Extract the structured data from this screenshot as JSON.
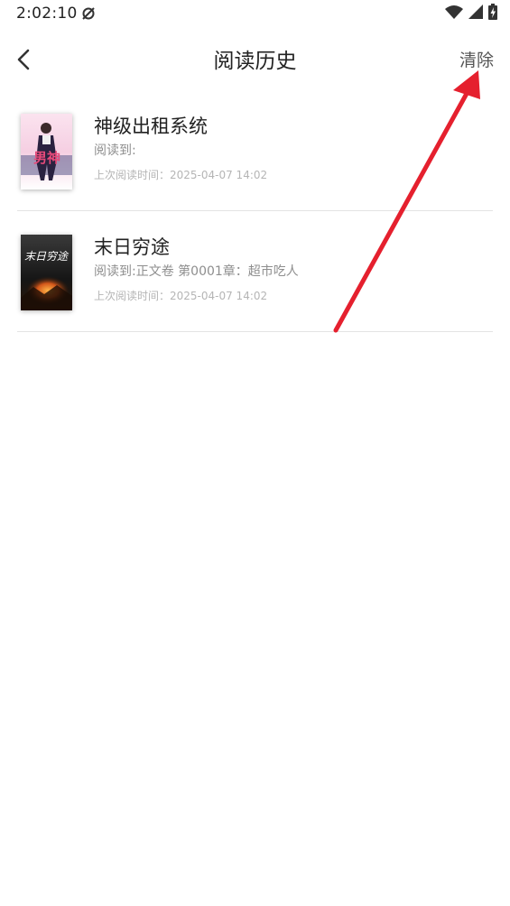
{
  "status_bar": {
    "time": "2:02:10"
  },
  "header": {
    "title": "阅读历史",
    "clear_label": "清除"
  },
  "history": [
    {
      "title": "神级出租系统",
      "progress": "阅读到:",
      "last_read": "上次阅读时间：2025-04-07 14:02",
      "cover_text": "男神"
    },
    {
      "title": "末日穷途",
      "progress": "阅读到:正文卷 第0001章：超市吃人",
      "last_read": "上次阅读时间：2025-04-07 14:02",
      "cover_text": "末日穷途"
    }
  ],
  "colors": {
    "annotation_arrow": "#e5202e",
    "divider": "#e3e3e3"
  },
  "icons": {
    "back": "chevron-left-icon",
    "wifi": "wifi-icon",
    "signal": "cell-signal-icon",
    "battery": "battery-charging-icon"
  }
}
